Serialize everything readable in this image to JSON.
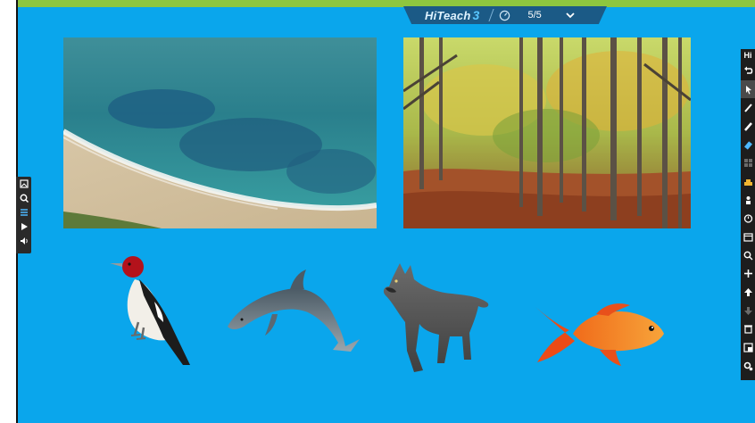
{
  "app": {
    "brand": "HiTeach",
    "version": "3"
  },
  "topbar": {
    "page_indicator": "5/5",
    "timer_icon": "stopwatch-icon",
    "menu_icon": "chevron-down-icon"
  },
  "right_toolbar": {
    "label": "Hi",
    "items": [
      "undo-icon",
      "pointer-icon",
      "pen-icon",
      "highlighter-icon",
      "eraser-icon",
      "grid-icon",
      "buzzer-icon",
      "group-icon",
      "timer-icon",
      "calendar-icon",
      "zoom-icon",
      "add-page-icon",
      "upload-icon",
      "download-icon",
      "delete-icon",
      "screenshot-icon",
      "settings-icon"
    ]
  },
  "left_toolbar": {
    "items": [
      "image-icon",
      "search-icon",
      "list-icon",
      "play-icon",
      "audio-icon"
    ]
  },
  "colors": {
    "stage": "#0aa6ec",
    "top_strip": "#8ec63f",
    "topbar": "#1b5a86"
  }
}
